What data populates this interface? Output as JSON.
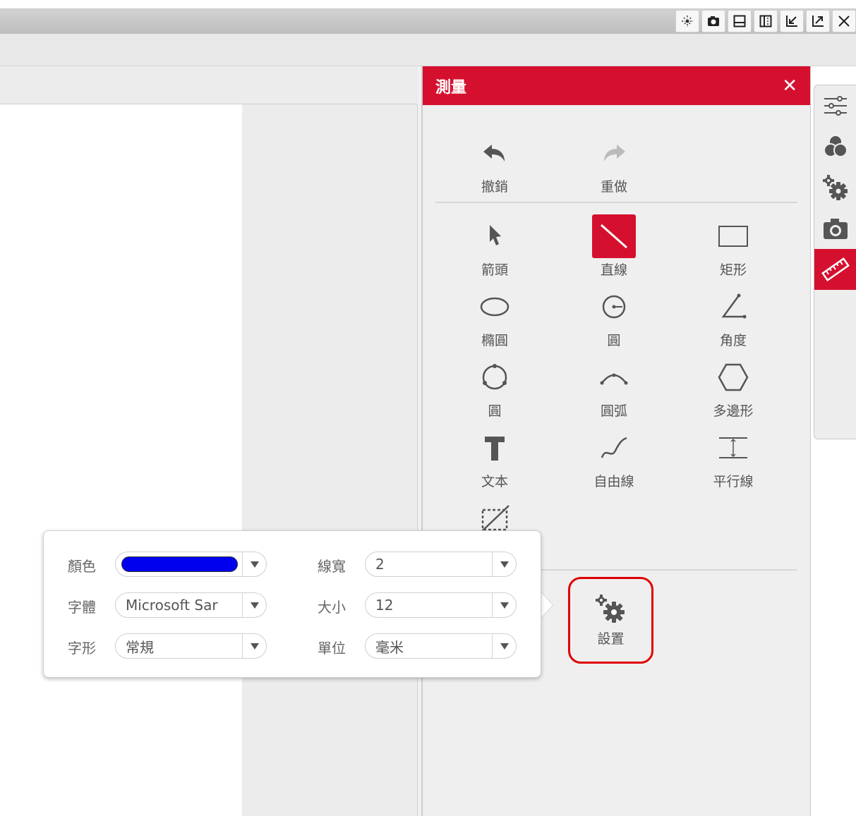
{
  "colors": {
    "accent": "#d5102e",
    "highlight": "#e00000",
    "line_color": "#0000ee"
  },
  "window_buttons": [
    {
      "name": "pin-icon"
    },
    {
      "name": "camera-icon"
    },
    {
      "name": "window-icon"
    },
    {
      "name": "split-icon"
    },
    {
      "name": "collapse-icon"
    },
    {
      "name": "expand-icon"
    },
    {
      "name": "close-icon"
    }
  ],
  "panel": {
    "title": "測量",
    "close_glyph": "✕",
    "undo_label": "撤銷",
    "redo_label": "重做",
    "tools": {
      "arrow": "箭頭",
      "line": "直線",
      "rect": "矩形",
      "ellipse": "橢圓",
      "circle_center": "圓",
      "angle": "角度",
      "circle_points": "圓",
      "arc": "圓弧",
      "polygon": "多邊形",
      "text": "文本",
      "freeline": "自由線",
      "parallel": "平行線"
    },
    "settings_label": "設置"
  },
  "settings_popup": {
    "color_label": "顏色",
    "font_label": "字體",
    "font_value": "Microsoft Sar",
    "style_label": "字形",
    "style_value": "常規",
    "width_label": "線寬",
    "width_value": "2",
    "size_label": "大小",
    "size_value": "12",
    "unit_label": "單位",
    "unit_value": "毫米"
  },
  "side_toolbar": [
    {
      "name": "adjust-icon",
      "active": false
    },
    {
      "name": "color-channels-icon",
      "active": false
    },
    {
      "name": "gears-icon",
      "active": false
    },
    {
      "name": "camera-icon",
      "active": false
    },
    {
      "name": "ruler-icon",
      "active": true
    }
  ]
}
